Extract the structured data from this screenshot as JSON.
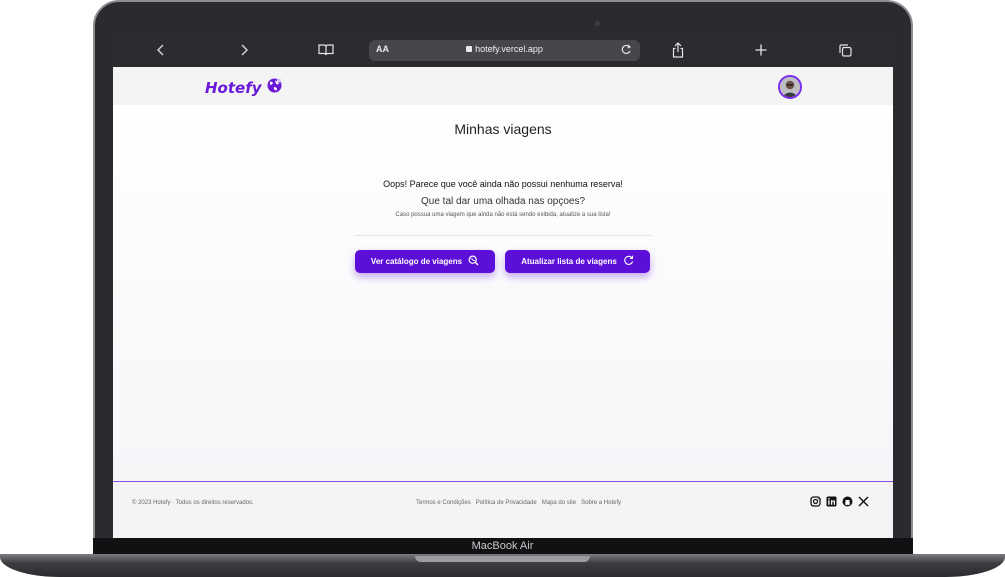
{
  "device": {
    "model_label": "MacBook Air"
  },
  "browser": {
    "aa_label": "AA",
    "url": "hotefy.vercel.app",
    "icons": [
      "back-icon",
      "forward-icon",
      "book-icon",
      "lock-icon",
      "reload-icon",
      "share-icon",
      "plus-icon",
      "tabs-icon"
    ]
  },
  "header": {
    "logo_text": "Hotefy",
    "logo_icon": "globe-icon",
    "avatar": "user-avatar"
  },
  "main": {
    "title": "Minhas viagens",
    "empty_message": "Oops! Parece que você ainda não possui nenhuma reserva!",
    "suggestion": "Que tal dar uma olhada nas opçoes?",
    "hint": "Caso possua uma viagem que ainda não está sendo exibida, atualize a sua lista!",
    "buttons": [
      {
        "label": "Ver catálogo de viagens",
        "icon": "search-globe-icon"
      },
      {
        "label": "Atualizar lista de viagens",
        "icon": "refresh-icon"
      }
    ]
  },
  "footer": {
    "copyright": "© 2023 Hotefy · Todos os direitos reservados.",
    "links": [
      "Termos e Condições",
      "Política de Privacidade",
      "Mapa do site",
      "Sobre a Hotefy"
    ],
    "socials": [
      "instagram-icon",
      "linkedin-icon",
      "github-icon",
      "x-icon"
    ]
  },
  "colors": {
    "accent": "#5b0fd8",
    "logo": "#6a19d9",
    "toolbar": "#2b2c30"
  }
}
